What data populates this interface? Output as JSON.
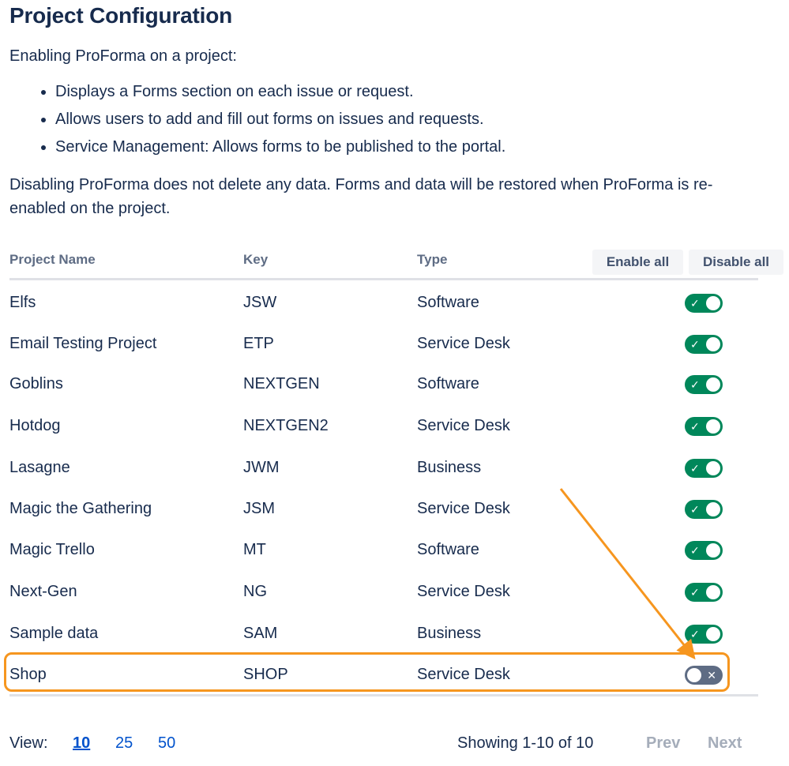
{
  "page": {
    "title": "Project Configuration",
    "intro": "Enabling ProForma on a project:",
    "bullets": [
      "Displays a Forms section on each issue or request.",
      "Allows users to add and fill out forms on issues and requests.",
      "Service Management: Allows forms to be published to the portal."
    ],
    "note": "Disabling ProForma does not delete any data. Forms and data will be restored when ProForma is re-enabled on the project."
  },
  "table": {
    "headers": {
      "name": "Project Name",
      "key": "Key",
      "type": "Type"
    },
    "enable_all_label": "Enable all",
    "disable_all_label": "Disable all",
    "rows": [
      {
        "name": "Elfs",
        "key": "JSW",
        "type": "Software",
        "enabled": true
      },
      {
        "name": "Email Testing Project",
        "key": "ETP",
        "type": "Service Desk",
        "enabled": true
      },
      {
        "name": "Goblins",
        "key": "NEXTGEN",
        "type": "Software",
        "enabled": true
      },
      {
        "name": "Hotdog",
        "key": "NEXTGEN2",
        "type": "Service Desk",
        "enabled": true
      },
      {
        "name": "Lasagne",
        "key": "JWM",
        "type": "Business",
        "enabled": true
      },
      {
        "name": "Magic the Gathering",
        "key": "JSM",
        "type": "Service Desk",
        "enabled": true
      },
      {
        "name": "Magic Trello",
        "key": "MT",
        "type": "Software",
        "enabled": true
      },
      {
        "name": "Next-Gen",
        "key": "NG",
        "type": "Service Desk",
        "enabled": true
      },
      {
        "name": "Sample data",
        "key": "SAM",
        "type": "Business",
        "enabled": true
      },
      {
        "name": "Shop",
        "key": "SHOP",
        "type": "Service Desk",
        "enabled": false
      }
    ]
  },
  "icons": {
    "toggle_on": "check-icon",
    "toggle_off": "cross-icon",
    "annotation": "arrow-annotation"
  },
  "colors": {
    "toggle_on": "#00875a",
    "toggle_off": "#5e6c84",
    "highlight": "#f6961f",
    "link": "#0052cc"
  },
  "footer": {
    "view_label": "View:",
    "page_sizes": [
      "10",
      "25",
      "50"
    ],
    "selected_page_size": "10",
    "showing": "Showing 1-10 of 10",
    "prev_label": "Prev",
    "next_label": "Next"
  }
}
